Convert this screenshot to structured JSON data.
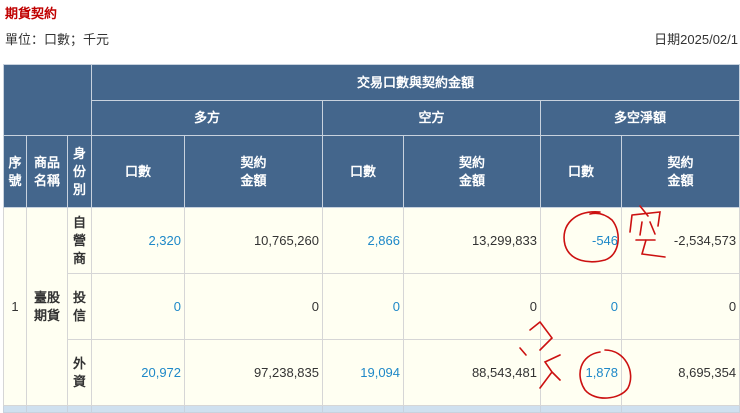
{
  "page": {
    "title": "期貨契約",
    "unit": "單位：口數；千元",
    "date": "日期2025/02/1"
  },
  "table": {
    "group_header": "交易口數與契約金額",
    "sub_headers": [
      "多方",
      "空方",
      "多空淨額"
    ],
    "col_headers": {
      "seq": "序號",
      "product": "商品名稱",
      "identity": "身份別",
      "lots": "口數",
      "amount": "契約金額"
    },
    "rows": [
      {
        "seq": "1",
        "product": "臺股期貨",
        "identity": "自營商",
        "long_lots": "2,320",
        "long_amount": "10,765,260",
        "short_lots": "2,866",
        "short_amount": "13,299,833",
        "net_lots": "-546",
        "net_amount": "-2,534,573"
      },
      {
        "identity": "投信",
        "long_lots": "0",
        "long_amount": "0",
        "short_lots": "0",
        "short_amount": "0",
        "net_lots": "0",
        "net_amount": "0"
      },
      {
        "identity": "外資",
        "long_lots": "20,972",
        "long_amount": "97,238,835",
        "short_lots": "19,094",
        "short_amount": "88,543,481",
        "net_lots": "1,878",
        "net_amount": "8,695,354"
      }
    ]
  },
  "annotations": [
    "空",
    "多"
  ],
  "colors": {
    "header": "#44668c",
    "title": "#c00000",
    "link": "#1e88c8",
    "ink": "#cc1111"
  }
}
